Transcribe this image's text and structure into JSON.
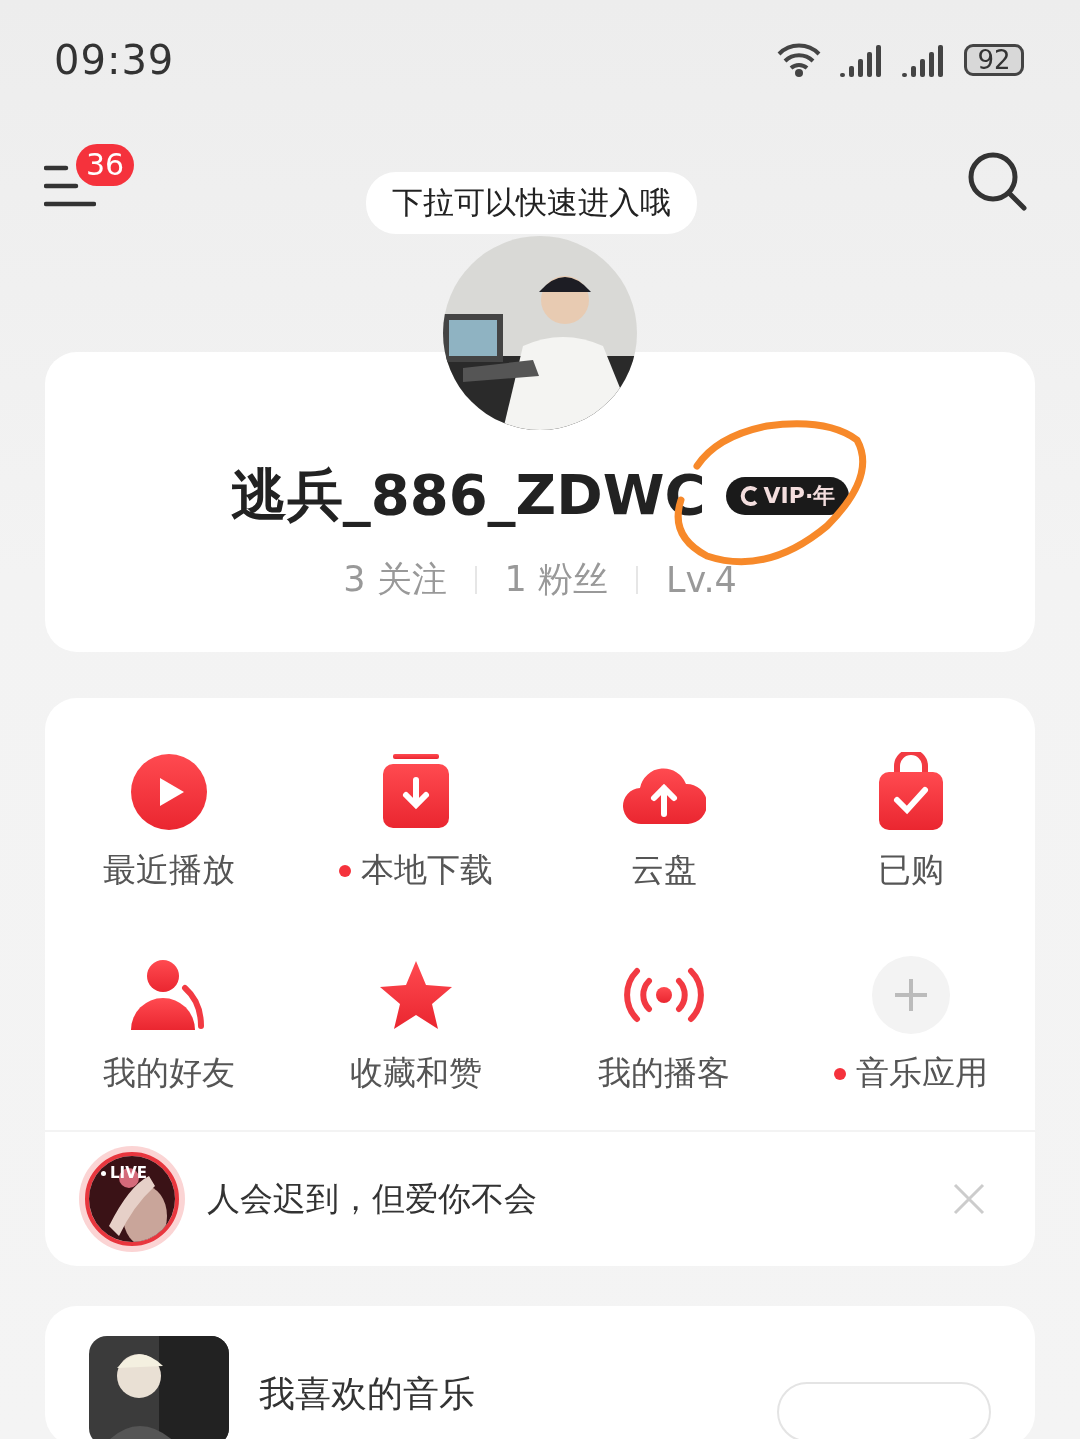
{
  "status_bar": {
    "time": "09:39",
    "battery": "92"
  },
  "header": {
    "notification_count": "36",
    "tip": "下拉可以快速进入哦"
  },
  "profile": {
    "name": "逃兵_886_ZDWC",
    "vip_badge": "VIP·年",
    "stats": [
      "3 关注",
      "1 粉丝",
      "Lv.4"
    ]
  },
  "shortcuts": [
    {
      "label": "最近播放",
      "kind": "play",
      "dot": false
    },
    {
      "label": "本地下载",
      "kind": "download",
      "dot": true
    },
    {
      "label": "云盘",
      "kind": "cloud",
      "dot": false
    },
    {
      "label": "已购",
      "kind": "bag",
      "dot": false
    },
    {
      "label": "我的好友",
      "kind": "friends",
      "dot": false
    },
    {
      "label": "收藏和赞",
      "kind": "star",
      "dot": false
    },
    {
      "label": "我的播客",
      "kind": "podcast",
      "dot": false
    },
    {
      "label": "音乐应用",
      "kind": "add",
      "dot": true
    }
  ],
  "live_banner": {
    "badge": "LIVE",
    "text": "人会迟到，但爱你不会"
  },
  "playlist": {
    "title": "我喜欢的音乐"
  }
}
